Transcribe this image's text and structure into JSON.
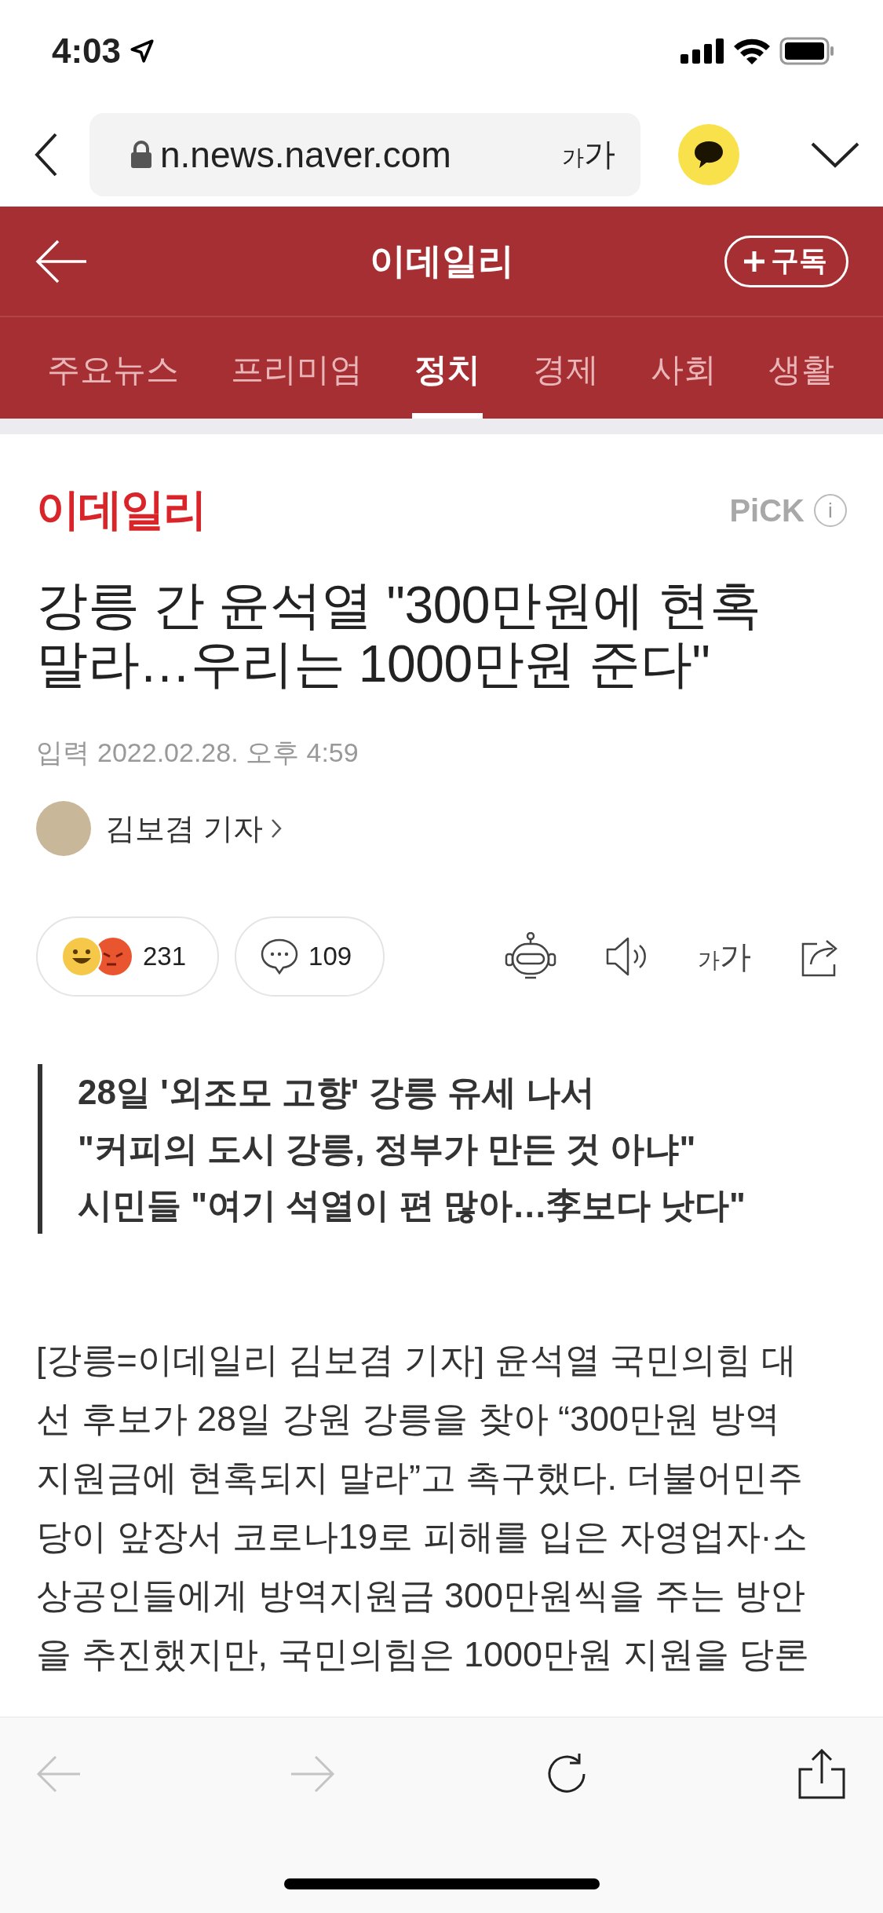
{
  "status_bar": {
    "time": "4:03"
  },
  "browser": {
    "url": "n.news.naver.com",
    "text_size": {
      "small": "가",
      "large": "가"
    }
  },
  "header": {
    "title": "이데일리",
    "subscribe": "구독"
  },
  "tabs": [
    {
      "label": "주요뉴스",
      "selected": false
    },
    {
      "label": "프리미엄",
      "selected": false
    },
    {
      "label": "정치",
      "selected": true
    },
    {
      "label": "경제",
      "selected": false
    },
    {
      "label": "사회",
      "selected": false
    },
    {
      "label": "생활",
      "selected": false
    }
  ],
  "article": {
    "press_logo": "이데일리",
    "pick": "PiCK",
    "info": "i",
    "headline_lines": [
      "강릉 간 윤석열 \"300만원에 현혹",
      "말라…우리는 1000만원 준다\""
    ],
    "date_label": "입력",
    "date": "2022.02.28. 오후 4:59",
    "author": "김보겸 기자",
    "reactions": "231",
    "comments": "109",
    "text_size": {
      "small": "가",
      "large": "가"
    },
    "summary": [
      "28일 '외조모 고향' 강릉 유세 나서",
      "\"커피의 도시 강릉, 정부가 만든 것 아냐\"",
      "시민들 \"여기 석열이 편 많아…李보다 낫다\""
    ],
    "body_lines": [
      "[강릉=이데일리 김보겸 기자] 윤석열 국민의힘 대",
      "선 후보가 28일 강원 강릉을 찾아 “300만원 방역",
      "지원금에 현혹되지 말라”고 촉구했다. 더불어민주",
      "당이 앞장서 코로나19로 피해를 입은 자영업자·소",
      "상공인들에게 방역지원금 300만원씩을 주는 방안",
      "을 추진했지만, 국민의힘은 1000만원 지원을 당론"
    ]
  }
}
